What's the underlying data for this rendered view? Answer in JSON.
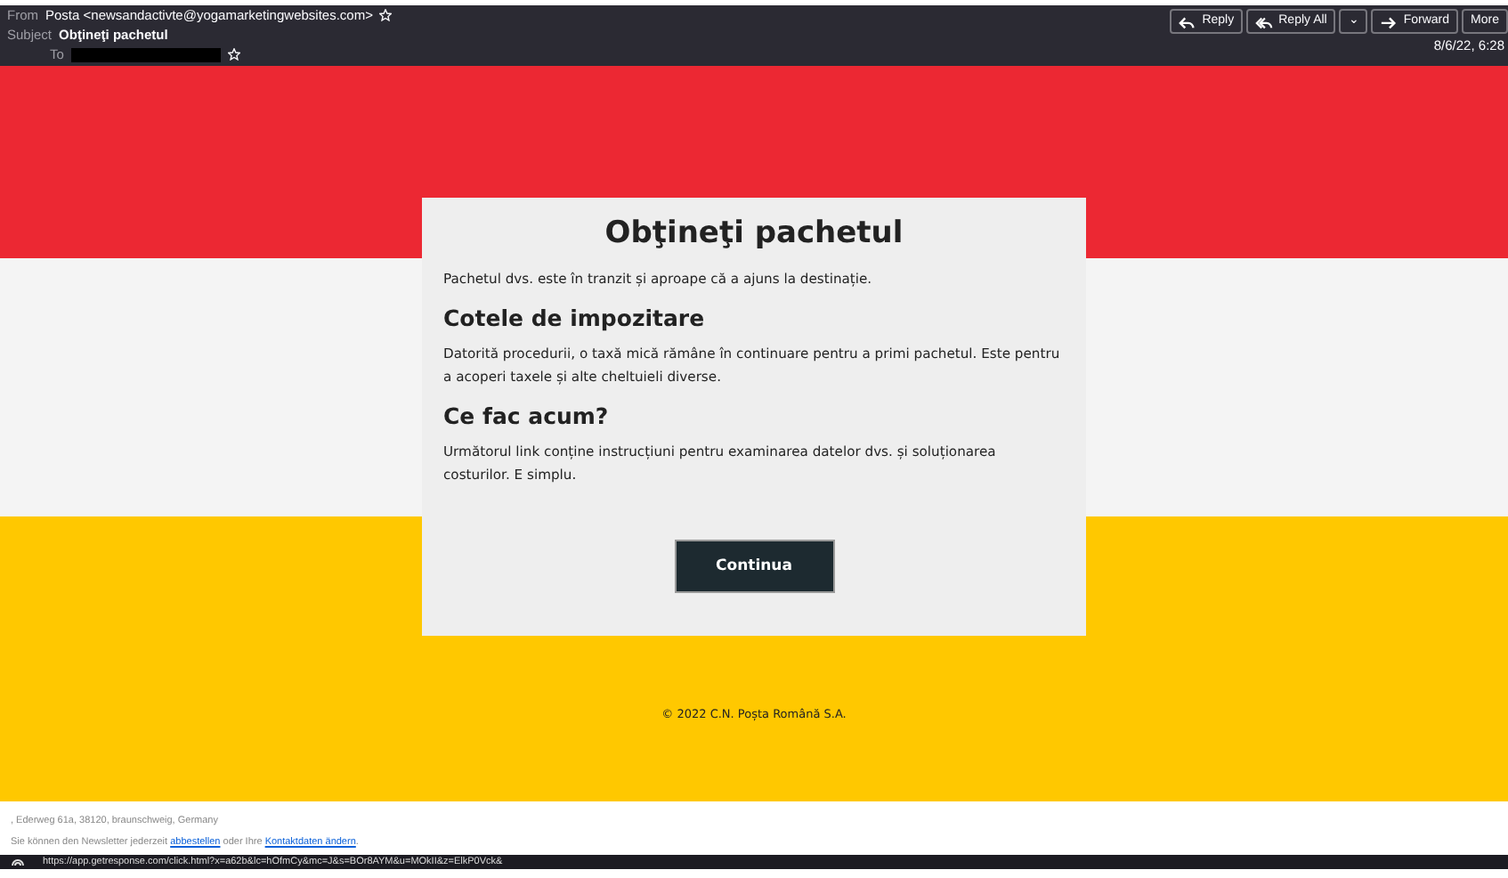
{
  "header": {
    "from_label": "From",
    "from": "Posta <newsandactivte@yogamarketingwebsites.com>",
    "from_starred": false,
    "subject_label": "Subject",
    "subject": "Obţineţi pachetul",
    "to_label": "To",
    "to_starred": false,
    "date": "8/6/22, 6:28",
    "actions": [
      {
        "kind": "reply",
        "label": "Reply"
      },
      {
        "kind": "replyall",
        "label": "Reply All"
      },
      {
        "kind": "dropdown",
        "label": "⌄"
      },
      {
        "kind": "forward",
        "label": "Forward"
      },
      {
        "kind": "plain",
        "label": "More"
      }
    ]
  },
  "email": {
    "title": "Obţineţi pachetul",
    "intro": "Pachetul dvs. este în tranzit și aproape că a ajuns la destinație.",
    "sections": [
      {
        "heading": "Cotele de impozitare",
        "text": "Datorită procedurii, o taxă mică rămâne în continuare pentru a primi pachetul. Este pentru a acoperi taxele și alte cheltuieli diverse."
      },
      {
        "heading": "Ce fac acum?",
        "text": "Următorul link conține instrucțiuni pentru examinarea datelor dvs. și soluționarea costurilor. E simplu."
      }
    ],
    "button": "Continua",
    "copyright": "© 2022 C.N. Poșta Română S.A."
  },
  "footer": {
    "address": ", Ederweg 61a, 38120, braunschweig, Germany",
    "newsletter_before": "Sie können den Newsletter jederzeit",
    "unsubscribe_link": "abbestellen",
    "newsletter_middle": "oder Ihre",
    "contact_link": "Kontaktdaten ändern",
    "newsletter_end": "."
  },
  "status_bar": {
    "url": "https://app.getresponse.com/click.html?x=a62b&lc=hOfmCy&mc=J&s=BOr8AYM&u=MOkII&z=ElkP0Vck&"
  }
}
